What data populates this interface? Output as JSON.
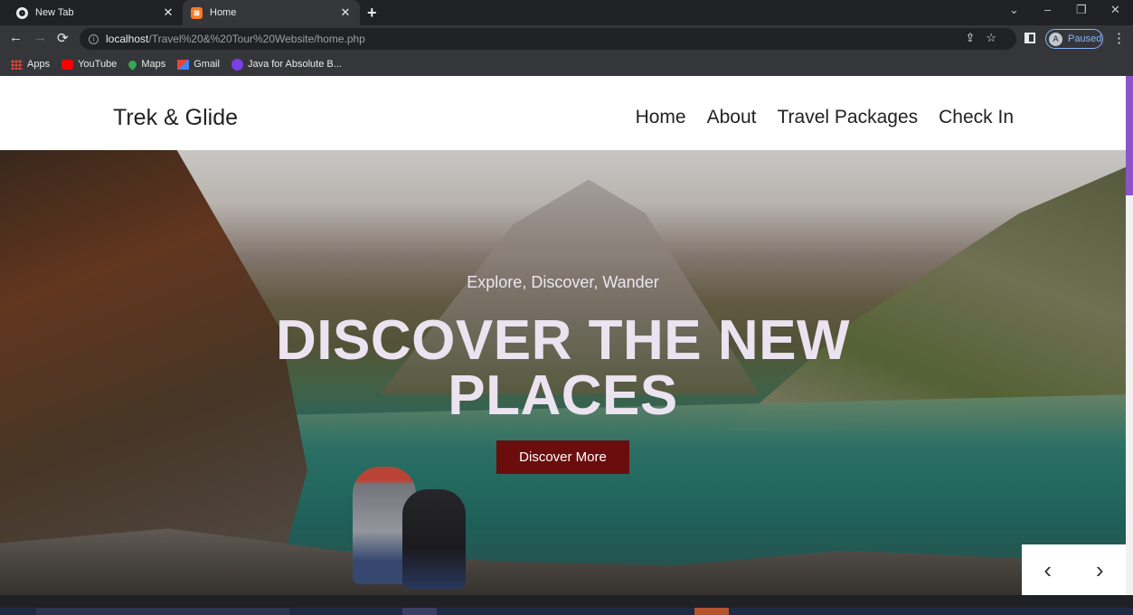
{
  "browser": {
    "tabs": [
      {
        "title": "New Tab",
        "icon": "chrome-icon",
        "active": false
      },
      {
        "title": "Home",
        "icon": "xampp-icon",
        "active": true
      }
    ],
    "close_glyph": "✕",
    "new_tab_glyph": "+",
    "window_controls": {
      "collapse": "⌄",
      "minimize": "–",
      "restore": "❐",
      "close": "✕"
    },
    "nav": {
      "back": "←",
      "forward": "→",
      "reload": "⟳"
    },
    "url": {
      "host": "localhost",
      "path": "/Travel%20&%20Tour%20Website/home.php"
    },
    "omnibox_icons": "⇪☆",
    "profile": {
      "initial": "A",
      "status": "Paused"
    },
    "menu_glyph": "⋮",
    "bookmarks": [
      {
        "label": "Apps",
        "icon": "apps-icon"
      },
      {
        "label": "YouTube",
        "icon": "youtube-icon"
      },
      {
        "label": "Maps",
        "icon": "maps-icon"
      },
      {
        "label": "Gmail",
        "icon": "gmail-icon"
      },
      {
        "label": "Java for Absolute B...",
        "icon": "java-icon"
      }
    ]
  },
  "site": {
    "logo": "Trek & Glide",
    "nav": [
      "Home",
      "About",
      "Travel Packages",
      "Check In"
    ],
    "hero": {
      "tagline": "Explore, Discover, Wander",
      "headline_line1": "DISCOVER THE NEW",
      "headline_line2": "PLACES",
      "cta": "Discover More"
    },
    "slider": {
      "prev": "‹",
      "next": "›"
    }
  },
  "colors": {
    "cta_bg": "#6b0d0d",
    "scroll_thumb": "#8d54c9",
    "browser_dark": "#202124",
    "toolbar": "#35363a"
  }
}
